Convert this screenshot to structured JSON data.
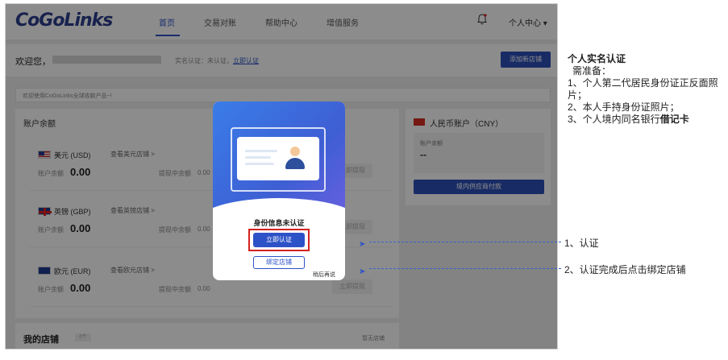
{
  "app": {
    "logo": "CoGoLinks",
    "nav": [
      "首页",
      "交易对账",
      "帮助中心",
      "增值服务"
    ],
    "user_menu": "个人中心 ▾"
  },
  "welcome": {
    "label": "欢迎您，",
    "auth_status": "实名认证：未认证，",
    "auth_link": "立即认证",
    "add_store_btn": "添加新店铺"
  },
  "notice": {
    "text": "欢迎使用CoGoLinks全球收款产品~!"
  },
  "balance": {
    "title": "账户余额",
    "currencies": [
      {
        "name": "美元 (USD)",
        "link": "查看美元店铺 >",
        "balance_label": "账户余额",
        "balance": "0.00",
        "withdraw_label": "提现中余额",
        "withdraw": "0.00",
        "withdraw_btn": "立即提现"
      },
      {
        "name": "英镑 (GBP)",
        "link": "查看英镑店铺 >",
        "balance_label": "账户余额",
        "balance": "0.00",
        "withdraw_label": "提现中余额",
        "withdraw": "0.00",
        "withdraw_btn": "立即提现"
      },
      {
        "name": "欧元 (EUR)",
        "link": "查看欧元店铺 >",
        "balance_label": "账户余额",
        "balance": "0.00",
        "withdraw_label": "提现中余额",
        "withdraw": "0.00",
        "withdraw_btn": "立即提现"
      }
    ]
  },
  "cny": {
    "title": "人民币账户（CNY）",
    "balance_label": "账户余额",
    "balance": "--",
    "pay_btn": "境内供应商付款"
  },
  "stores": {
    "title": "我的店铺",
    "count": "0个",
    "empty": "暂无店铺"
  },
  "modal": {
    "status": "身份信息未认证",
    "verify_btn": "立即认证",
    "bind_btn": "绑定店铺",
    "later": "稍后再说"
  },
  "callouts": {
    "step1": "1、认证",
    "step2": "2、认证完成后点击绑定店铺"
  },
  "instructions": {
    "title": "个人实名认证",
    "prepare": "需准备：",
    "item1": "1、个人第二代居民身份证正反面照片；",
    "item2": "2、本人手持身份证照片；",
    "item3_prefix": "3、个人境内同名银行",
    "item3_bold": "借记卡"
  },
  "colors": {
    "brand": "#2d52c7",
    "highlight": "#d42020"
  }
}
